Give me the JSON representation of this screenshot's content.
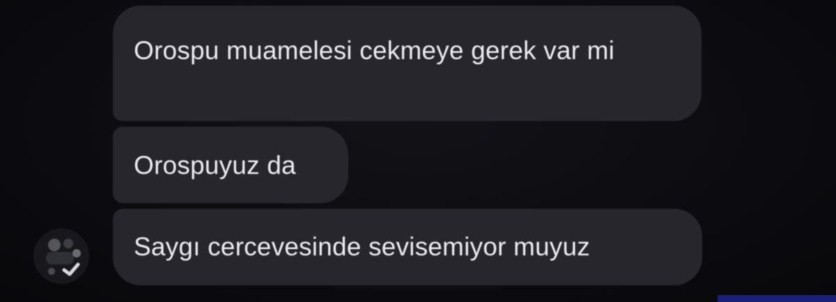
{
  "messages": [
    {
      "text": "Orospu muamelesi cekmeye gerek var mi"
    },
    {
      "text": "Orospuyuz da"
    },
    {
      "text": "Saygı cercevesinde sevisemiyor muyuz"
    }
  ],
  "avatar": {
    "icon": "user-avatar-icon"
  },
  "colors": {
    "background": "#0e0e12",
    "bubble": "#26262c",
    "text": "#ececf0"
  }
}
